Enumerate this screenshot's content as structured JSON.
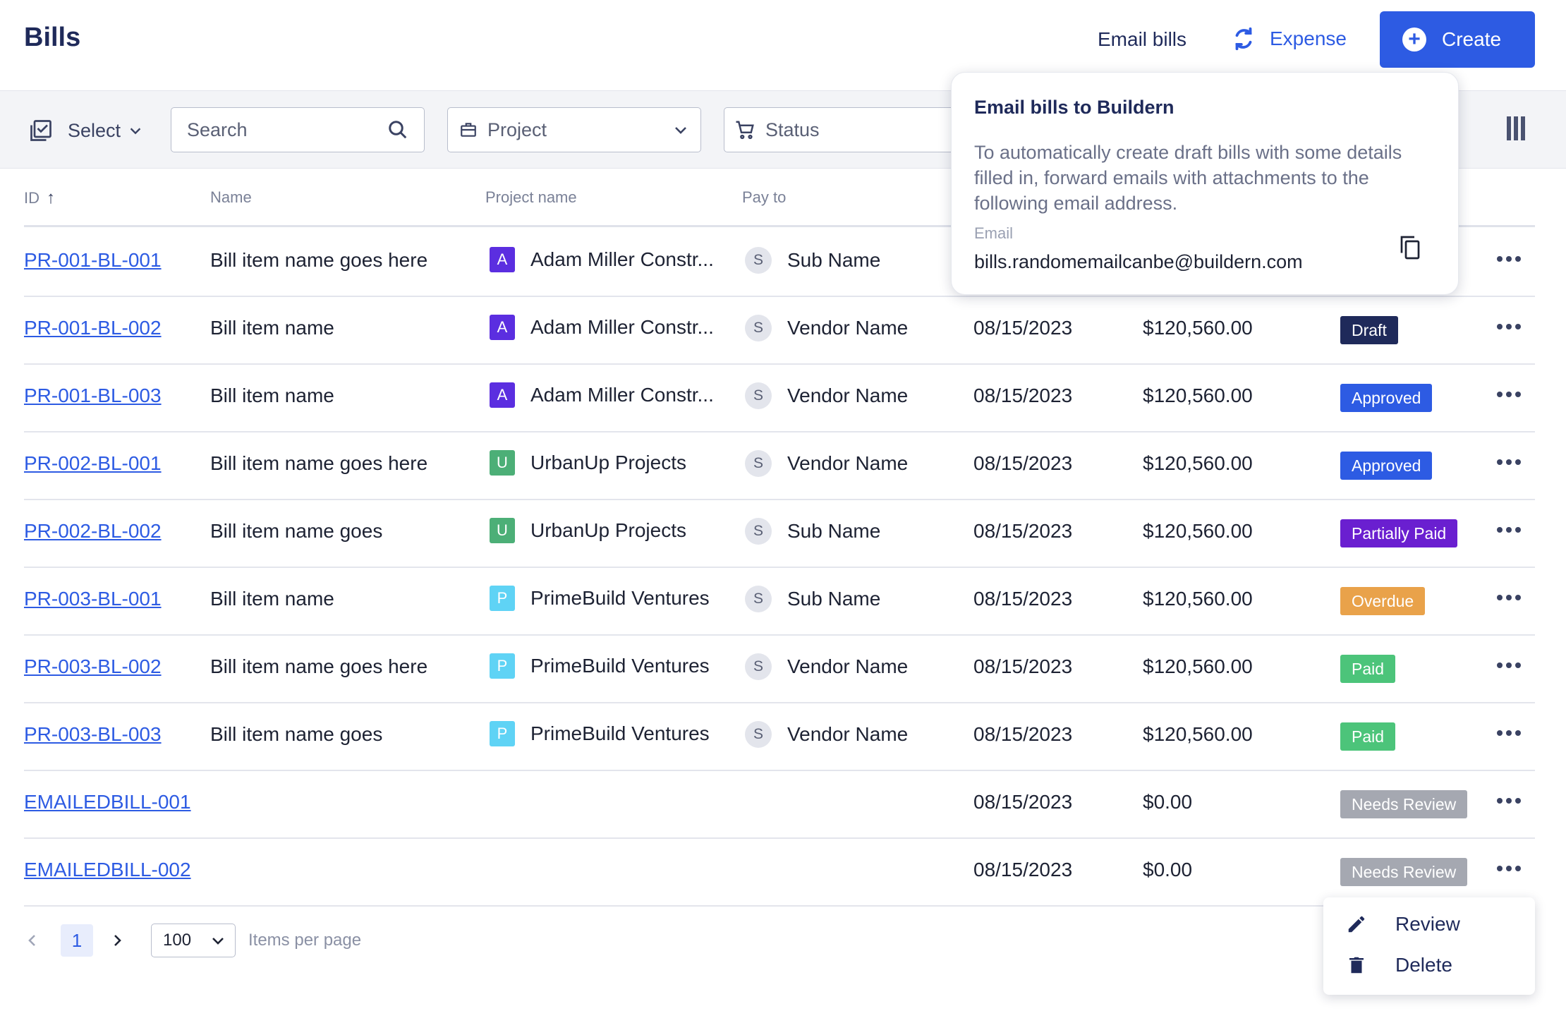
{
  "header": {
    "title": "Bills",
    "email_bills": "Email bills",
    "expense": "Expense",
    "create": "Create"
  },
  "toolbar": {
    "select_label": "Select",
    "search_placeholder": "Search",
    "project_label": "Project",
    "status_label": "Status"
  },
  "table": {
    "columns": [
      "ID",
      "Name",
      "Project name",
      "Pay to"
    ],
    "rows": [
      {
        "id": "PR-001-BL-001",
        "name": "Bill item name goes here",
        "project_initial": "A",
        "project": "Adam Miller Constr...",
        "payto_initial": "S",
        "payto": "Sub Name",
        "date": "",
        "amount": "",
        "status": ""
      },
      {
        "id": "PR-001-BL-002",
        "name": "Bill item name",
        "project_initial": "A",
        "project": "Adam Miller Constr...",
        "payto_initial": "S",
        "payto": "Vendor Name",
        "date": "08/15/2023",
        "amount": "$120,560.00",
        "status": "Draft"
      },
      {
        "id": "PR-001-BL-003",
        "name": "Bill item name",
        "project_initial": "A",
        "project": "Adam Miller Constr...",
        "payto_initial": "S",
        "payto": "Vendor Name",
        "date": "08/15/2023",
        "amount": "$120,560.00",
        "status": "Approved"
      },
      {
        "id": "PR-002-BL-001",
        "name": "Bill item name goes here",
        "project_initial": "U",
        "project": "UrbanUp Projects",
        "payto_initial": "S",
        "payto": "Vendor Name",
        "date": "08/15/2023",
        "amount": "$120,560.00",
        "status": "Approved"
      },
      {
        "id": "PR-002-BL-002",
        "name": "Bill item name goes",
        "project_initial": "U",
        "project": "UrbanUp Projects",
        "payto_initial": "S",
        "payto": "Sub Name",
        "date": "08/15/2023",
        "amount": "$120,560.00",
        "status": "Partially Paid"
      },
      {
        "id": "PR-003-BL-001",
        "name": "Bill item name",
        "project_initial": "P",
        "project": "PrimeBuild Ventures",
        "payto_initial": "S",
        "payto": "Sub Name",
        "date": "08/15/2023",
        "amount": "$120,560.00",
        "status": "Overdue"
      },
      {
        "id": "PR-003-BL-002",
        "name": "Bill item name goes here",
        "project_initial": "P",
        "project": "PrimeBuild Ventures",
        "payto_initial": "S",
        "payto": "Vendor Name",
        "date": "08/15/2023",
        "amount": "$120,560.00",
        "status": "Paid"
      },
      {
        "id": "PR-003-BL-003",
        "name": "Bill item name goes",
        "project_initial": "P",
        "project": "PrimeBuild Ventures",
        "payto_initial": "S",
        "payto": "Vendor Name",
        "date": "08/15/2023",
        "amount": "$120,560.00",
        "status": "Paid"
      },
      {
        "id": "EMAILEDBILL-001",
        "name": "",
        "project_initial": "",
        "project": "",
        "payto_initial": "",
        "payto": "",
        "date": "08/15/2023",
        "amount": "$0.00",
        "status": "Needs Review"
      },
      {
        "id": "EMAILEDBILL-002",
        "name": "",
        "project_initial": "",
        "project": "",
        "payto_initial": "",
        "payto": "",
        "date": "08/15/2023",
        "amount": "$0.00",
        "status": "Needs Review"
      }
    ]
  },
  "colors": {
    "accent": "#2d5be3",
    "project_A": "#5b2ee0",
    "project_U": "#4caf77",
    "project_P": "#5fd3f5",
    "status_Draft": "#1f2a5a",
    "status_Approved": "#2d5be3",
    "status_Partially Paid": "#6a1fd0",
    "status_Overdue": "#e9a24a",
    "status_Paid": "#4cc47a",
    "status_Needs Review": "#a5a8b1"
  },
  "popover": {
    "title": "Email bills to Buildern",
    "body": "To automatically create draft bills with some details filled in, forward emails with attachments to the following email address.",
    "label": "Email",
    "email": "bills.randomemailcanbe@buildern.com"
  },
  "pagination": {
    "current_page": "1",
    "page_size": "100",
    "label": "Items per page"
  },
  "context_menu": {
    "review": "Review",
    "delete": "Delete"
  }
}
